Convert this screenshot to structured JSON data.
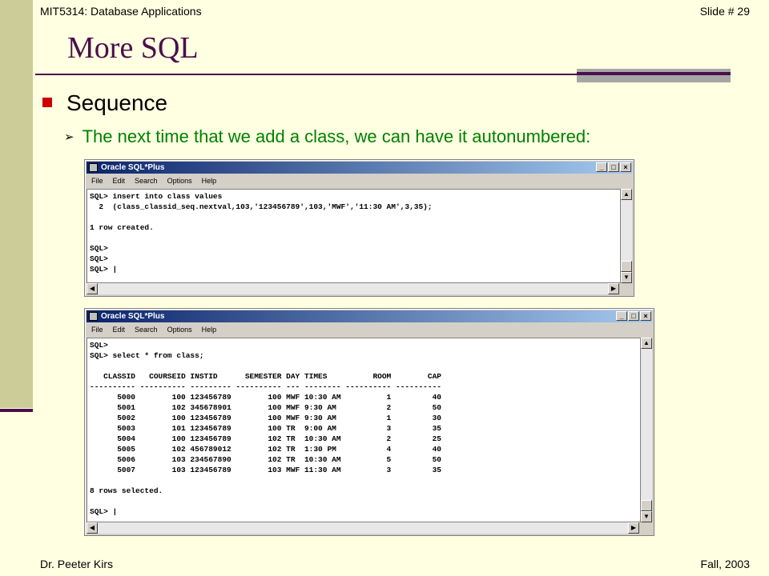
{
  "header": {
    "course": "MIT5314: Database Applications",
    "slide": "Slide # 29"
  },
  "title": "More SQL",
  "bullet1": "Sequence",
  "bullet2": "The next time that we add a class, we can have it autonumbered:",
  "window1": {
    "title": "Oracle SQL*Plus",
    "menu": [
      "File",
      "Edit",
      "Search",
      "Options",
      "Help"
    ],
    "console": "SQL> insert into class values\n  2  (class_classid_seq.nextval,103,'123456789',103,'MWF','11:30 AM',3,35);\n\n1 row created.\n\nSQL>\nSQL>\nSQL> |"
  },
  "window2": {
    "title": "Oracle SQL*Plus",
    "menu": [
      "File",
      "Edit",
      "Search",
      "Options",
      "Help"
    ],
    "console": "SQL>\nSQL> select * from class;\n\n   CLASSID   COURSEID INSTID      SEMESTER DAY TIMES          ROOM        CAP\n---------- ---------- --------- ---------- --- -------- ---------- ----------\n      5000        100 123456789        100 MWF 10:30 AM          1         40\n      5001        102 345678901        100 MWF 9:30 AM           2         50\n      5002        100 123456789        100 MWF 9:30 AM           1         30\n      5003        101 123456789        100 TR  9:00 AM           3         35\n      5004        100 123456789        102 TR  10:30 AM          2         25\n      5005        102 456789012        102 TR  1:30 PM           4         40\n      5006        103 234567890        102 TR  10:30 AM          5         50\n      5007        103 123456789        103 MWF 11:30 AM          3         35\n\n8 rows selected.\n\nSQL> |"
  },
  "footer": {
    "author": "Dr. Peeter Kirs",
    "term": "Fall, 2003"
  }
}
